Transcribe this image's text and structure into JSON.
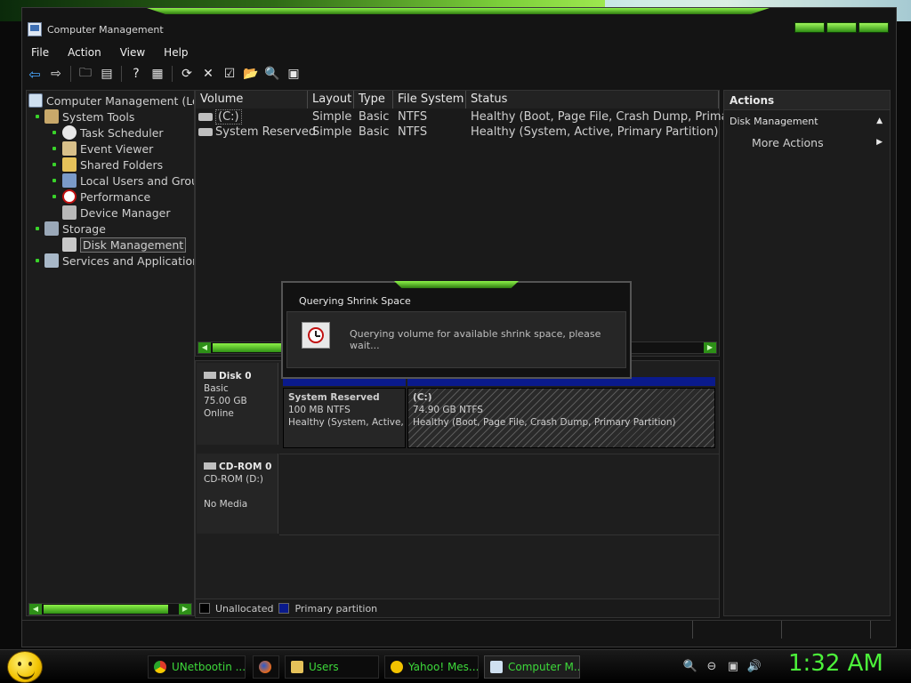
{
  "window": {
    "title": "Computer Management"
  },
  "menu": [
    "File",
    "Action",
    "View",
    "Help"
  ],
  "tree": {
    "root": "Computer Management (Loc",
    "system_tools": "System Tools",
    "task_scheduler": "Task Scheduler",
    "event_viewer": "Event Viewer",
    "shared_folders": "Shared Folders",
    "local_users": "Local Users and Grou",
    "performance": "Performance",
    "device_manager": "Device Manager",
    "storage": "Storage",
    "disk_management": "Disk Management",
    "services": "Services and Applications"
  },
  "volumes": {
    "columns": [
      "Volume",
      "Layout",
      "Type",
      "File System",
      "Status"
    ],
    "rows": [
      {
        "volume": "(C:)",
        "layout": "Simple",
        "type": "Basic",
        "fs": "NTFS",
        "status": "Healthy (Boot, Page File, Crash Dump, Primary"
      },
      {
        "volume": "System Reserved",
        "layout": "Simple",
        "type": "Basic",
        "fs": "NTFS",
        "status": "Healthy (System, Active, Primary Partition)"
      }
    ]
  },
  "disks": {
    "disk0": {
      "name": "Disk 0",
      "type": "Basic",
      "size": "75.00 GB",
      "state": "Online"
    },
    "cdrom0": {
      "name": "CD-ROM 0",
      "drive": "CD-ROM (D:)",
      "state": "No Media"
    },
    "partitions": {
      "reserved": {
        "name": "System Reserved",
        "size": "100 MB NTFS",
        "status": "Healthy (System, Active, P"
      },
      "c": {
        "name": "(C:)",
        "size": "74.90 GB NTFS",
        "status": "Healthy (Boot, Page File, Crash Dump, Primary Partition)"
      }
    }
  },
  "legend": {
    "unallocated": "Unallocated",
    "primary": "Primary partition",
    "unallocated_color": "#000000",
    "primary_color": "#0a1a8c"
  },
  "actions": {
    "header": "Actions",
    "section": "Disk Management",
    "more": "More Actions"
  },
  "dialog": {
    "title": "Querying Shrink Space",
    "message": "Querying volume for available shrink space, please wait..."
  },
  "taskbar": {
    "tasks": [
      "UNetbootin ...",
      "Users",
      "Yahoo! Mes...",
      "Computer M..."
    ],
    "clock": "1:32 AM"
  },
  "colors": {
    "accent_green": "#4cf23a",
    "primary_partition": "#0a1a8c"
  }
}
